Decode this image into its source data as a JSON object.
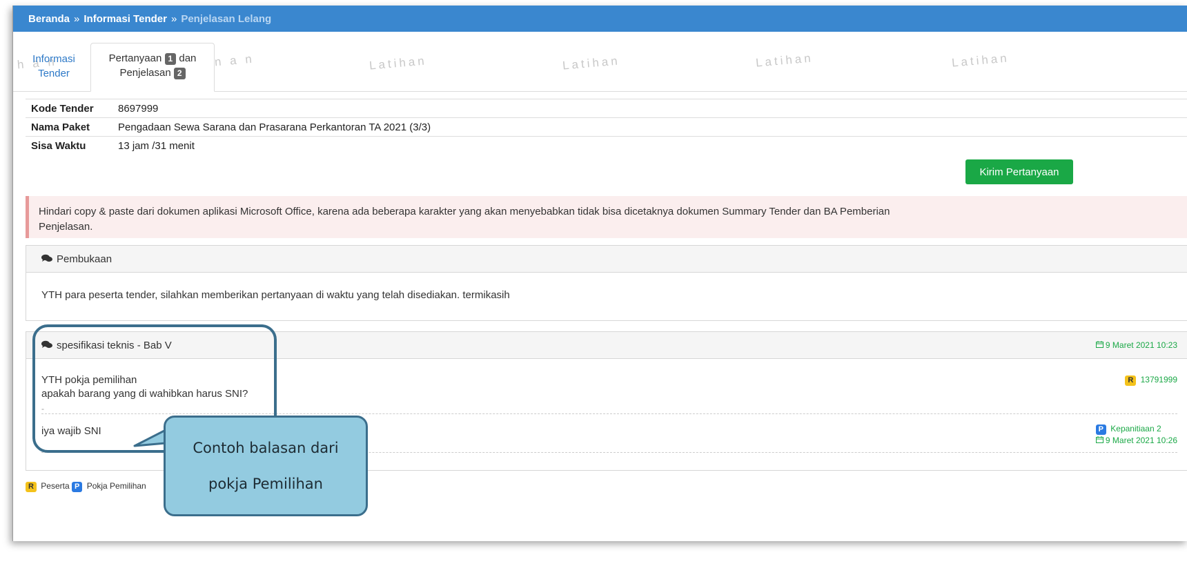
{
  "breadcrumb": {
    "items": [
      "Beranda",
      "Informasi Tender",
      "Penjelasan Lelang"
    ],
    "separator": "»"
  },
  "tabs": [
    {
      "label_line1": "Informasi",
      "label_line2": "Tender"
    },
    {
      "label_line1": "Pertanyaan",
      "badge1": "1",
      "label_mid": "dan",
      "label_line2": "Penjelasan",
      "badge2": "2"
    }
  ],
  "watermark": "Latihan",
  "watermark_partial": [
    "h a n",
    "n a n"
  ],
  "info": [
    {
      "key": "Kode Tender",
      "value": "8697999"
    },
    {
      "key": "Nama Paket",
      "value": "Pengadaan Sewa Sarana dan Prasarana Perkantoran TA 2021 (3/3)"
    },
    {
      "key": "Sisa Waktu",
      "value": "13 jam /31 menit"
    }
  ],
  "kirim_button": "Kirim Pertanyaan",
  "alert_line1": "Hindari copy & paste dari dokumen aplikasi Microsoft Office, karena ada beberapa karakter yang akan menyebabkan tidak bisa dicetaknya dokumen Summary Tender dan BA Pemberian",
  "alert_line2": "Penjelasan.",
  "opening": {
    "title": "Pembukaan",
    "body": "YTH para peserta tender, silahkan memberikan pertanyaan di waktu yang telah disediakan. termikasih"
  },
  "question": {
    "title": "spesifikasi teknis - Bab V",
    "date": "9 Maret 2021 10:23",
    "line1": "YTH pokja pemilihan",
    "line2": "apakah barang yang di wahibkan harus SNI?",
    "sender_badge": "R",
    "sender": "13791999",
    "separator": "-",
    "answer": "iya wajib SNI",
    "answer_badge": "P",
    "answer_sender": "Kepanitiaan 2",
    "answer_date": "9 Maret 2021 10:26"
  },
  "legend": {
    "r_badge": "R",
    "r_label": "Peserta",
    "p_badge": "P",
    "p_label": "Pokja Pemilihan"
  },
  "callout": {
    "line1": "Contoh balasan dari",
    "line2": "pokja Pemilihan"
  },
  "colors": {
    "topbar": "#3a87cf",
    "green": "#1aa846",
    "link": "#2d79c7",
    "alert_bg": "#fbeeee",
    "callout_fill": "#93cbe0",
    "callout_border": "#3b6e8c"
  }
}
